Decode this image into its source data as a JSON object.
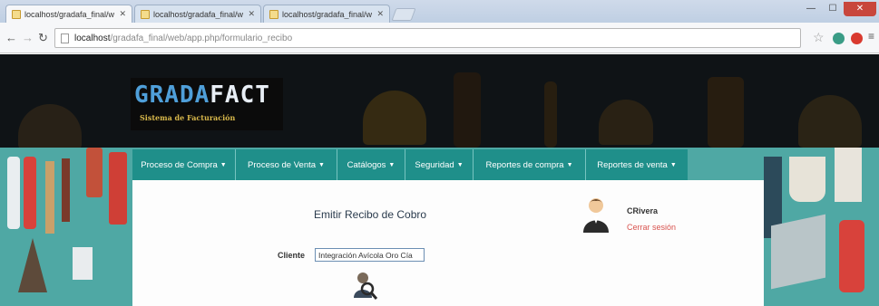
{
  "browser": {
    "tabs": [
      {
        "title": "localhost/gradafa_final/w",
        "active": true
      },
      {
        "title": "localhost/gradafa_final/w",
        "active": false
      },
      {
        "title": "localhost/gradafa_final/w",
        "active": false
      }
    ],
    "address": {
      "host": "localhost",
      "path": "/gradafa_final/web/app.php/formulario_recibo"
    }
  },
  "brand": {
    "title_part1": "GRADA",
    "title_part2": "FACT",
    "subtitle": "Sistema de Facturación"
  },
  "nav": {
    "items": [
      {
        "label": "Proceso de Compra",
        "caret": "▼"
      },
      {
        "label": "Proceso de Venta",
        "caret": "▼"
      },
      {
        "label": "Catálogos",
        "caret": "▼"
      },
      {
        "label": "Seguridad",
        "caret": "▼"
      },
      {
        "label": "Reportes de compra",
        "caret": "▼"
      },
      {
        "label": "Reportes de venta",
        "caret": "▼"
      }
    ]
  },
  "main": {
    "title": "Emitir Recibo de Cobro",
    "cliente_label": "Cliente",
    "cliente_value": "Integración Avícola Oro Cía"
  },
  "user": {
    "name": "CRivera",
    "logout_label": "Cerrar sesión"
  },
  "colors": {
    "nav_bg": "#1f8f8a",
    "header_bg": "#0f1316",
    "background_teal": "#4fa8a4",
    "logout": "#d9534f"
  }
}
